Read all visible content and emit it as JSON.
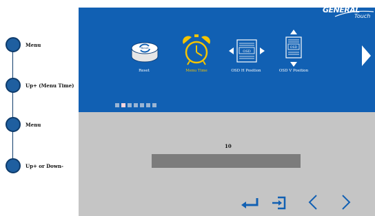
{
  "steps": [
    {
      "label": "Menu"
    },
    {
      "label": "Up+ (Menu Time)"
    },
    {
      "label": "Menu"
    },
    {
      "label": "Up+ or Down-"
    }
  ],
  "brand": {
    "line1": "GENERAL",
    "line2": "Touch"
  },
  "menu_items": [
    {
      "label": "Reset",
      "icon_text": "Reset",
      "active": false
    },
    {
      "label": "Menu Time",
      "active": true
    },
    {
      "label": "OSD H Position",
      "icon_text": "OSD",
      "active": false
    },
    {
      "label": "OSD V Position",
      "icon_text": "OSD",
      "active": false
    }
  ],
  "page_indicator": {
    "total": 7,
    "current": 2
  },
  "value_display": {
    "value": "10"
  },
  "colors": {
    "panel_blue": "#1160b3",
    "active_yellow": "#f5c400",
    "panel_gray": "#c5c5c5",
    "bar_gray": "#7c7c7c",
    "step_dot": "#1f5fa0"
  },
  "icons": {
    "next": "chevron-right-icon",
    "enter": "enter-icon",
    "exit": "exit-icon",
    "left": "chevron-left-icon",
    "right": "chevron-right-icon"
  }
}
